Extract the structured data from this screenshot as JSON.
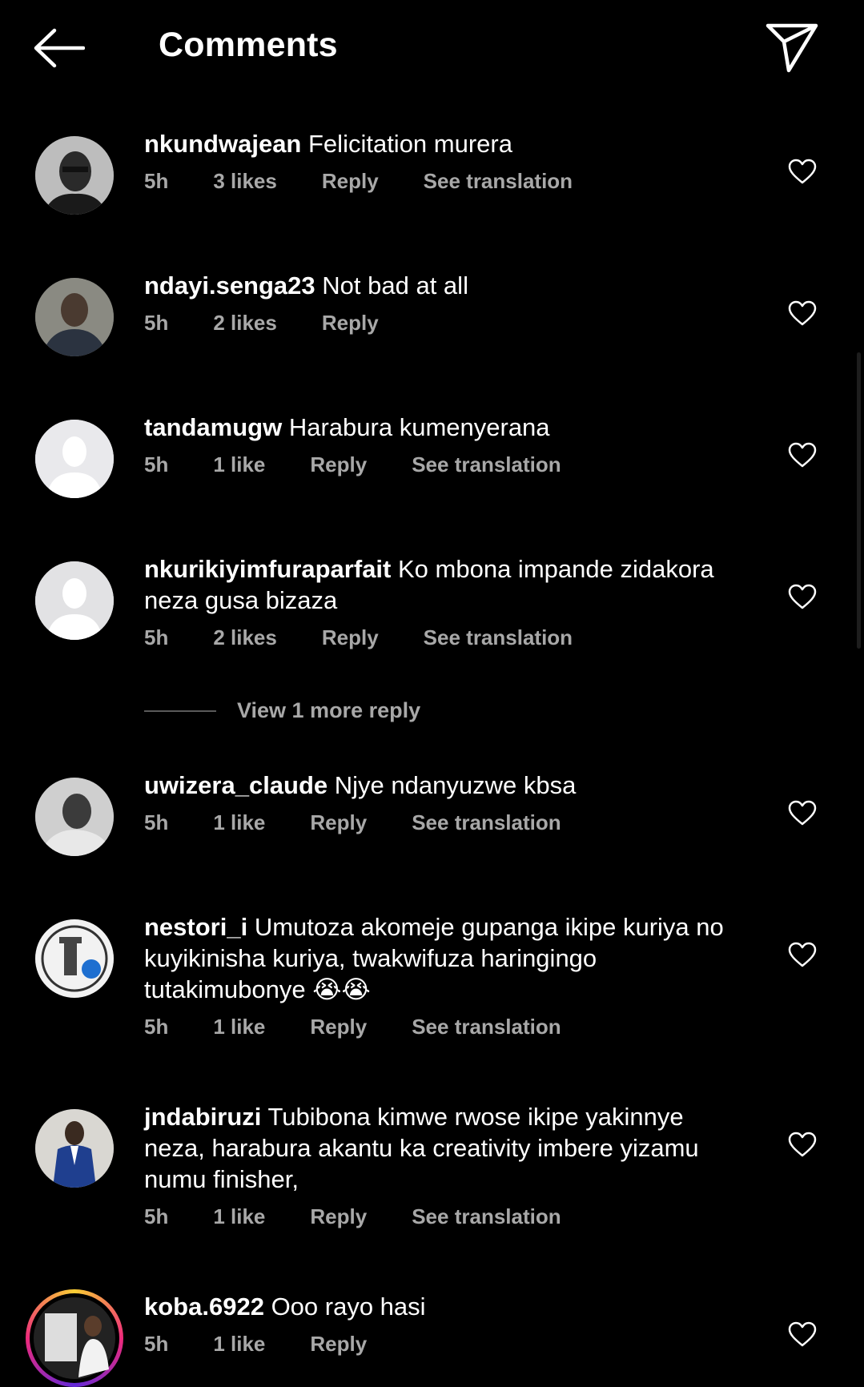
{
  "header": {
    "title": "Comments",
    "back_icon": "arrow-left-icon",
    "send_icon": "send-icon"
  },
  "comments": [
    {
      "username": "nkundwajean",
      "text": "Felicitation murera",
      "time": "5h",
      "likes": "3 likes",
      "reply": "Reply",
      "translate": "See translation"
    },
    {
      "username": "ndayi.senga23",
      "text": "Not bad at all",
      "time": "5h",
      "likes": "2 likes",
      "reply": "Reply",
      "translate": ""
    },
    {
      "username": "tandamugw",
      "text": "Harabura kumenyerana",
      "time": "5h",
      "likes": "1 like",
      "reply": "Reply",
      "translate": "See translation"
    },
    {
      "username": "nkurikiyimfuraparfait",
      "text": "Ko mbona impande zidakora neza gusa bizaza",
      "time": "5h",
      "likes": "2 likes",
      "reply": "Reply",
      "translate": "See translation"
    },
    {
      "username": "uwizera_claude",
      "text": "Njye ndanyuzwe kbsa",
      "time": "5h",
      "likes": "1 like",
      "reply": "Reply",
      "translate": "See translation"
    },
    {
      "username": "nestori_i",
      "text": "Umutoza akomeje gupanga ikipe kuriya no kuyikinisha kuriya, twakwifuza haringingo tutakimubonye 😭😭",
      "time": "5h",
      "likes": "1 like",
      "reply": "Reply",
      "translate": "See translation"
    },
    {
      "username": "jndabiruzi",
      "text": "Tubibona kimwe rwose ikipe yakinnye neza, harabura akantu ka creativity imbere yizamu numu finisher,",
      "time": "5h",
      "likes": "1 like",
      "reply": "Reply",
      "translate": "See translation"
    },
    {
      "username": "koba.6922",
      "text": "Ooo rayo hasi",
      "time": "5h",
      "likes": "1 like",
      "reply": "Reply",
      "translate": ""
    }
  ],
  "view_more": {
    "label": "View 1 more reply"
  }
}
